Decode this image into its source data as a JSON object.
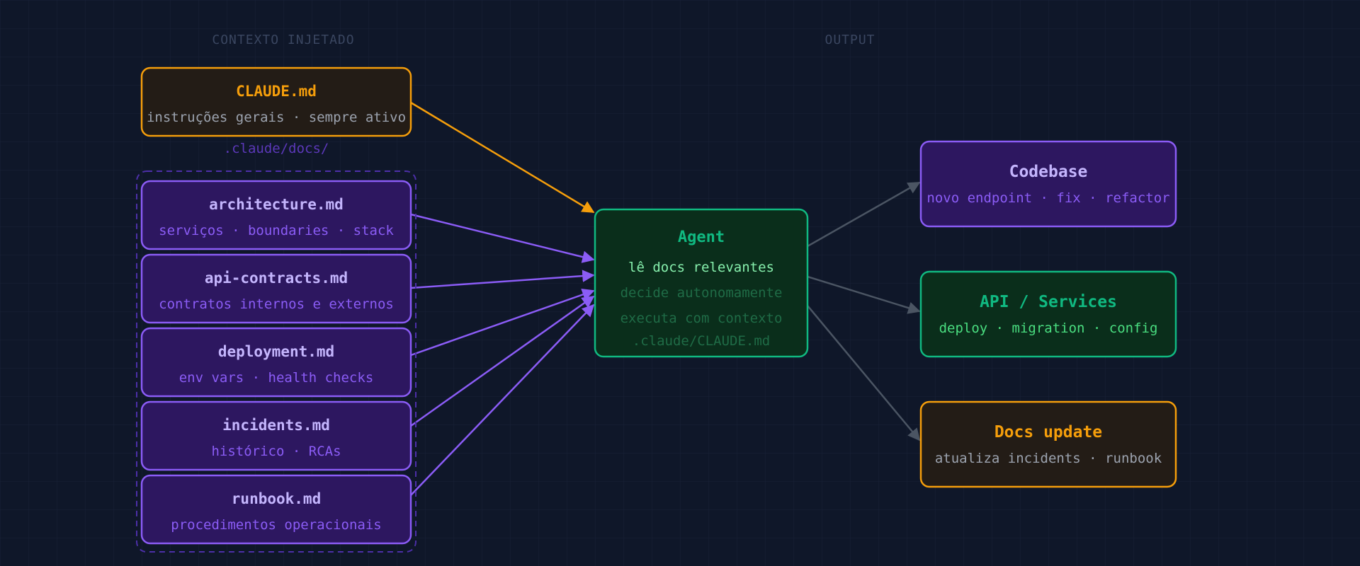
{
  "sections": {
    "context_label": "CONTEXTO INJETADO",
    "output_label": "OUTPUT"
  },
  "claude_md": {
    "title": "CLAUDE.md",
    "subtitle": "instruções gerais · sempre ativo"
  },
  "docs_group": {
    "label": ".claude/docs/",
    "docs": [
      {
        "title": "architecture.md",
        "subtitle": "serviços · boundaries · stack"
      },
      {
        "title": "api-contracts.md",
        "subtitle": "contratos internos e externos"
      },
      {
        "title": "deployment.md",
        "subtitle": "env vars · health checks"
      },
      {
        "title": "incidents.md",
        "subtitle": "histórico · RCAs"
      },
      {
        "title": "runbook.md",
        "subtitle": "procedimentos operacionais"
      }
    ]
  },
  "agent": {
    "title": "Agent",
    "line1": "lê docs relevantes",
    "line2": "decide autonomamente",
    "line3": "executa com contexto",
    "line4": ".claude/CLAUDE.md"
  },
  "outputs": [
    {
      "title": "Codebase",
      "subtitle": "novo endpoint · fix · refactor",
      "theme": "purple"
    },
    {
      "title": "API / Services",
      "subtitle": "deploy · migration · config",
      "theme": "green"
    },
    {
      "title": "Docs update",
      "subtitle": "atualiza incidents · runbook",
      "theme": "orange"
    }
  ],
  "colors": {
    "background": "#0f1729",
    "purple_fill": "#2d1760",
    "purple_stroke": "#8b5cf6",
    "purple_title": "#c4b5fd",
    "purple_sub": "#8b5cf6",
    "green_fill": "#0a2e1b",
    "green_stroke": "#10b981",
    "green_title": "#10b981",
    "green_sub": "#4ade80",
    "orange_fill": "#231c16",
    "orange_stroke": "#f59e0b",
    "orange_title": "#f59e0b",
    "gray_text": "#9ca3af",
    "gray_arrow": "#4b5563"
  }
}
